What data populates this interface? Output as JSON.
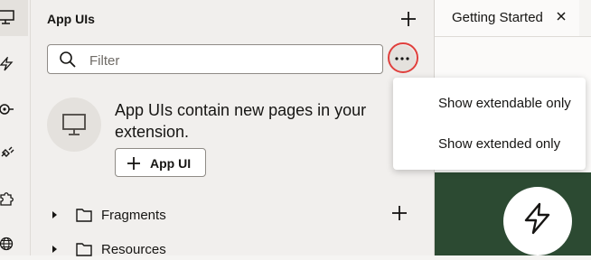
{
  "panel": {
    "title": "App UIs",
    "filter_placeholder": "Filter",
    "empty_message": "App UIs contain new pages in your extension.",
    "add_button_label": "App UI"
  },
  "tree": {
    "items": [
      {
        "label": "Fragments"
      },
      {
        "label": "Resources"
      }
    ]
  },
  "editor": {
    "tab_label": "Getting Started"
  },
  "menu": {
    "items": [
      {
        "label": "Show extendable only"
      },
      {
        "label": "Show extended only"
      }
    ]
  },
  "rail": {
    "icons": [
      "desktop-icon",
      "lightning-icon",
      "plug-icon",
      "connector-icon",
      "puzzle-icon",
      "globe-icon"
    ]
  },
  "colors": {
    "highlight_ring": "#e0403d",
    "green_card": "#2c4a32"
  }
}
